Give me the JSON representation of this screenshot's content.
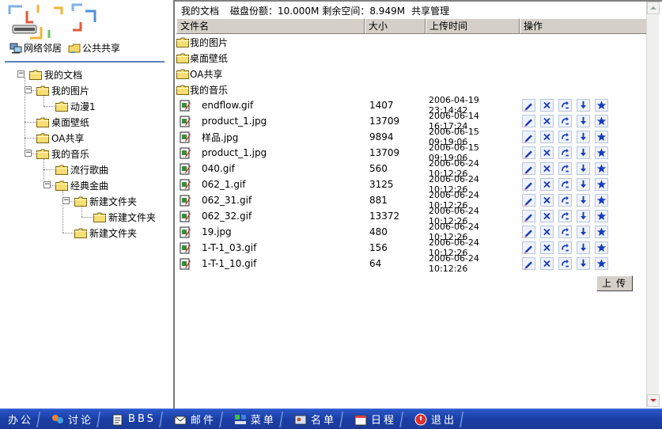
{
  "left": {
    "quick_links": [
      {
        "label": "网络邻居",
        "icon": "network-neighborhood-icon"
      },
      {
        "label": "公共共享",
        "icon": "public-share-icon"
      }
    ],
    "tree": [
      {
        "label": "我的文档",
        "level": 0,
        "expander": "−"
      },
      {
        "label": "我的图片",
        "level": 1,
        "expander": "−"
      },
      {
        "label": "动漫1",
        "level": 2
      },
      {
        "label": "桌面壁纸",
        "level": 1
      },
      {
        "label": "OA共享",
        "level": 1
      },
      {
        "label": "我的音乐",
        "level": 1,
        "expander": "−"
      },
      {
        "label": "流行歌曲",
        "level": 2
      },
      {
        "label": "经典金曲",
        "level": 2,
        "expander": "−"
      },
      {
        "label": "新建文件夹",
        "level": 3,
        "expander": "−"
      },
      {
        "label": "新建文件夹",
        "level": 4
      },
      {
        "label": "新建文件夹",
        "level": 3
      }
    ]
  },
  "top": {
    "folder": "我的文档",
    "quota": "磁盘份额：10.000M",
    "free": "剩余空间：8.949M",
    "share": "共享管理"
  },
  "table": {
    "headers": [
      "文件名",
      "大小",
      "上传时间",
      "操作"
    ],
    "folders": [
      "我的图片",
      "桌面壁纸",
      "OA共享",
      "我的音乐"
    ],
    "files": [
      {
        "name": "endflow.gif",
        "size": "1407",
        "time": "2006-04-19 23:14:42"
      },
      {
        "name": "product_1.jpg",
        "size": "13709",
        "time": "2006-06-14 16:17:24"
      },
      {
        "name": "样品.jpg",
        "size": "9894",
        "time": "2006-06-15 09:19:06"
      },
      {
        "name": "product_1.jpg",
        "size": "13709",
        "time": "2006-06-15 09:19:06"
      },
      {
        "name": "040.gif",
        "size": "560",
        "time": "2006-06-24 10:12:26"
      },
      {
        "name": "062_1.gif",
        "size": "3125",
        "time": "2006-06-24 10:12:26"
      },
      {
        "name": "062_31.gif",
        "size": "881",
        "time": "2006-06-24 10:12:26"
      },
      {
        "name": "062_32.gif",
        "size": "13372",
        "time": "2006-06-24 10:12:26"
      },
      {
        "name": "19.jpg",
        "size": "480",
        "time": "2006-06-24 10:12:26"
      },
      {
        "name": "1-T-1_03.gif",
        "size": "156",
        "time": "2006-06-24 10:12:26"
      },
      {
        "name": "1-T-1_10.gif",
        "size": "64",
        "time": "2006-06-24 10:12:26"
      }
    ],
    "actions": [
      "edit-icon",
      "delete-icon",
      "rename-icon",
      "download-icon",
      "favorite-icon"
    ],
    "upload_label": "上传"
  },
  "taskbar": [
    {
      "label": "办公",
      "icon": "office-icon"
    },
    {
      "label": "讨论",
      "icon": "discussion-icon"
    },
    {
      "label": "BBS",
      "icon": "bbs-icon"
    },
    {
      "label": "邮件",
      "icon": "mail-icon"
    },
    {
      "label": "菜单",
      "icon": "menu-icon"
    },
    {
      "label": "名单",
      "icon": "contacts-icon"
    },
    {
      "label": "日程",
      "icon": "calendar-icon"
    },
    {
      "label": "退出",
      "icon": "exit-icon"
    }
  ],
  "colors": {
    "taskbar": "#1b3fa6",
    "folder": "#f5d868",
    "accent": "#5b82b8"
  }
}
